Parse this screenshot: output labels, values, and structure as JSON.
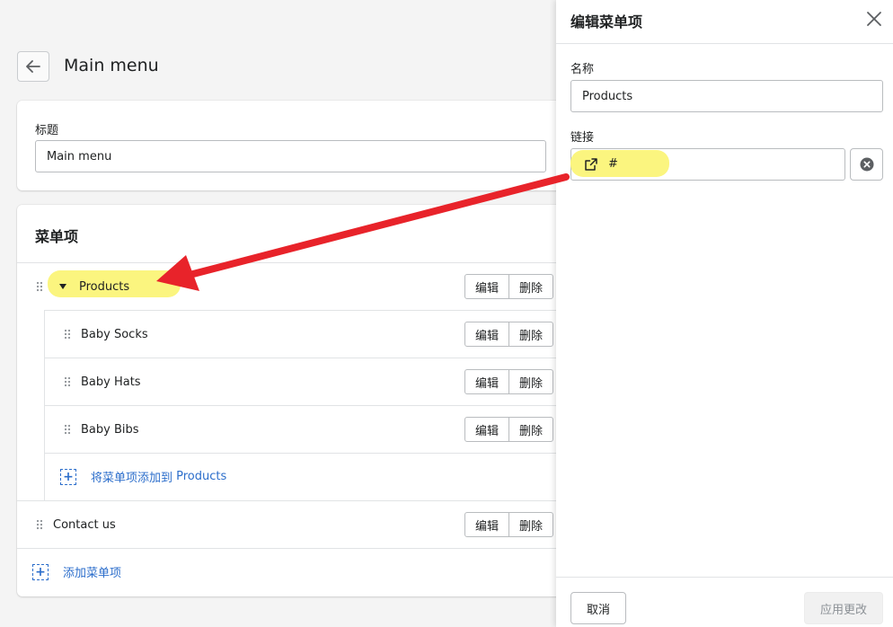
{
  "page": {
    "title": "Main menu"
  },
  "title_card": {
    "label": "标题",
    "value": "Main menu"
  },
  "menu_card": {
    "heading": "菜单项",
    "items": [
      {
        "label": "Products",
        "edit": "编辑",
        "delete": "删除"
      },
      {
        "label": "Baby Socks",
        "edit": "编辑",
        "delete": "删除"
      },
      {
        "label": "Baby Hats",
        "edit": "编辑",
        "delete": "删除"
      },
      {
        "label": "Baby Bibs",
        "edit": "编辑",
        "delete": "删除"
      },
      {
        "label": "Contact us",
        "edit": "编辑",
        "delete": "删除"
      }
    ],
    "add_child_prefix": "将菜单项添加到 ",
    "add_child_target": "Products",
    "add_item": "添加菜单项"
  },
  "panel": {
    "title": "编辑菜单项",
    "name_label": "名称",
    "name_value": "Products",
    "link_label": "链接",
    "link_value": "#",
    "cancel": "取消",
    "apply": "应用更改"
  },
  "colors": {
    "highlight": "#fbf57f",
    "annotation_arrow": "#e8232a",
    "link_blue": "#2c6ecb"
  }
}
